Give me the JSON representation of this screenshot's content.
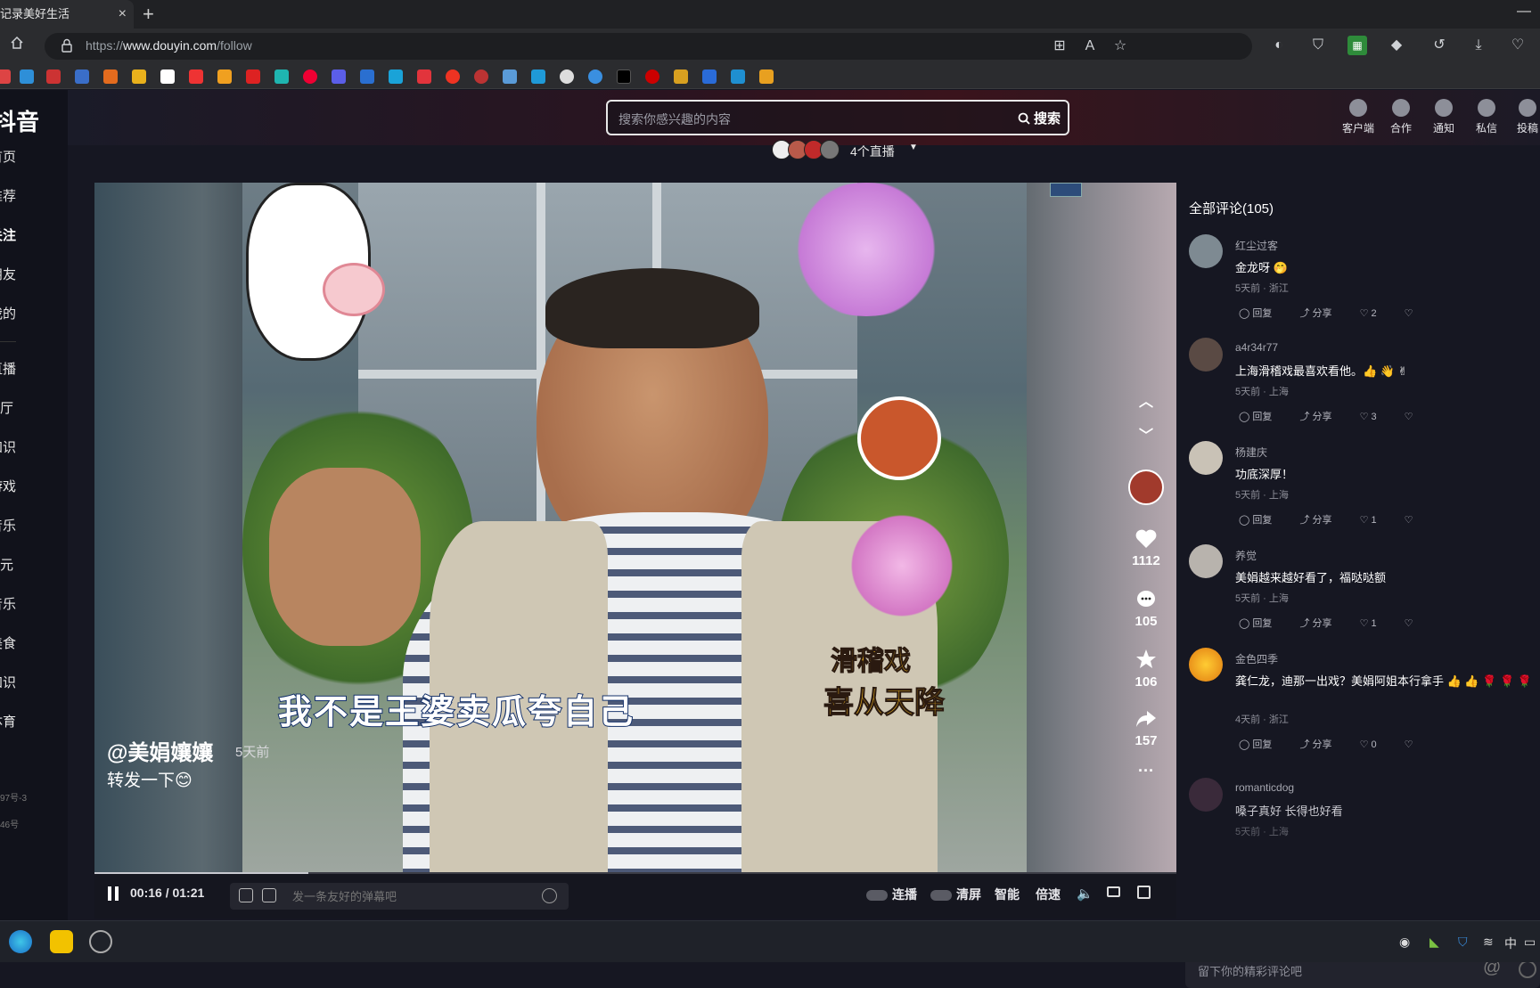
{
  "browser": {
    "tab_title": "记录美好生活",
    "tab_close": "×",
    "new_tab": "+",
    "minimize": "—",
    "url_prefix": "https://",
    "url_host": "www.douyin.com",
    "url_path": "/follow"
  },
  "sidebar": {
    "logo": "抖音",
    "items": [
      "首页",
      "推荐",
      "关注",
      "朋友",
      "我的",
      "直播",
      "放映厅",
      "知识",
      "游戏",
      "二次元",
      "音乐",
      "美食",
      "知识",
      "体育"
    ],
    "footer_1": "97号-3",
    "footer_2": "46号"
  },
  "header": {
    "search_placeholder": "搜索你感兴趣的内容",
    "search_button": "搜索",
    "icons": [
      {
        "label": "客户端",
        "icon": "desktop-icon"
      },
      {
        "label": "合作",
        "icon": "handshake-icon"
      },
      {
        "label": "通知",
        "icon": "bell-icon"
      },
      {
        "label": "私信",
        "icon": "message-icon"
      },
      {
        "label": "投稿",
        "icon": "upload-icon"
      }
    ]
  },
  "live": {
    "count_label": "4个直播"
  },
  "video": {
    "subtitle": "我不是王婆卖瓜夸自己",
    "author": "@美娟孃孃",
    "post_time": "5天前",
    "caption": "转发一下😊",
    "stamp": "滑稽戏",
    "stamp_2": "喜从天降",
    "likes": "1112",
    "comments": "105",
    "favorites": "106",
    "shares": "157",
    "more": "···",
    "progress_fraction": 0.198
  },
  "controls": {
    "time": "00:16 / 01:21",
    "danmu_placeholder": "发一条友好的弹幕吧",
    "autoplay": "连播",
    "clear": "清屏",
    "smart": "智能",
    "speed": "倍速"
  },
  "comments": {
    "header": "全部评论(105)",
    "reply": "回复",
    "share": "分享",
    "list": [
      {
        "name": "红尘过客",
        "text": "金龙呀 🤭",
        "meta": "5天前 · 浙江",
        "likes": "2",
        "avatar_color": "#7e8a92"
      },
      {
        "name": "a4r34r77",
        "text": "上海滑稽戏最喜欢看他。👍 👋 ✌",
        "meta": "5天前 · 上海",
        "likes": "3",
        "avatar_color": "#5a4a44"
      },
      {
        "name": "杨建庆",
        "text": "功底深厚！",
        "meta": "5天前 · 上海",
        "likes": "1",
        "avatar_color": "#c9c2b6"
      },
      {
        "name": "养觉",
        "text": "美娟越来越好看了，福哒哒额",
        "meta": "5天前 · 上海",
        "likes": "1",
        "avatar_color": "#b8b3ad"
      },
      {
        "name": "金色四季",
        "text": "龚仁龙，迪那一出戏？美娟阿姐本行拿手 👍 👍 🌹 🌹 🌹",
        "meta": "4天前 · 浙江",
        "likes": "0",
        "avatar_color": "#e8901a"
      },
      {
        "name": "romanticdog",
        "text": "嗓子真好 长得也好看",
        "meta": "5天前 · 上海",
        "likes": "",
        "avatar_color": "#3a2a3a"
      }
    ],
    "input_placeholder": "留下你的精彩评论吧",
    "at_symbol": "@"
  },
  "taskbar": {
    "ime": "中"
  }
}
